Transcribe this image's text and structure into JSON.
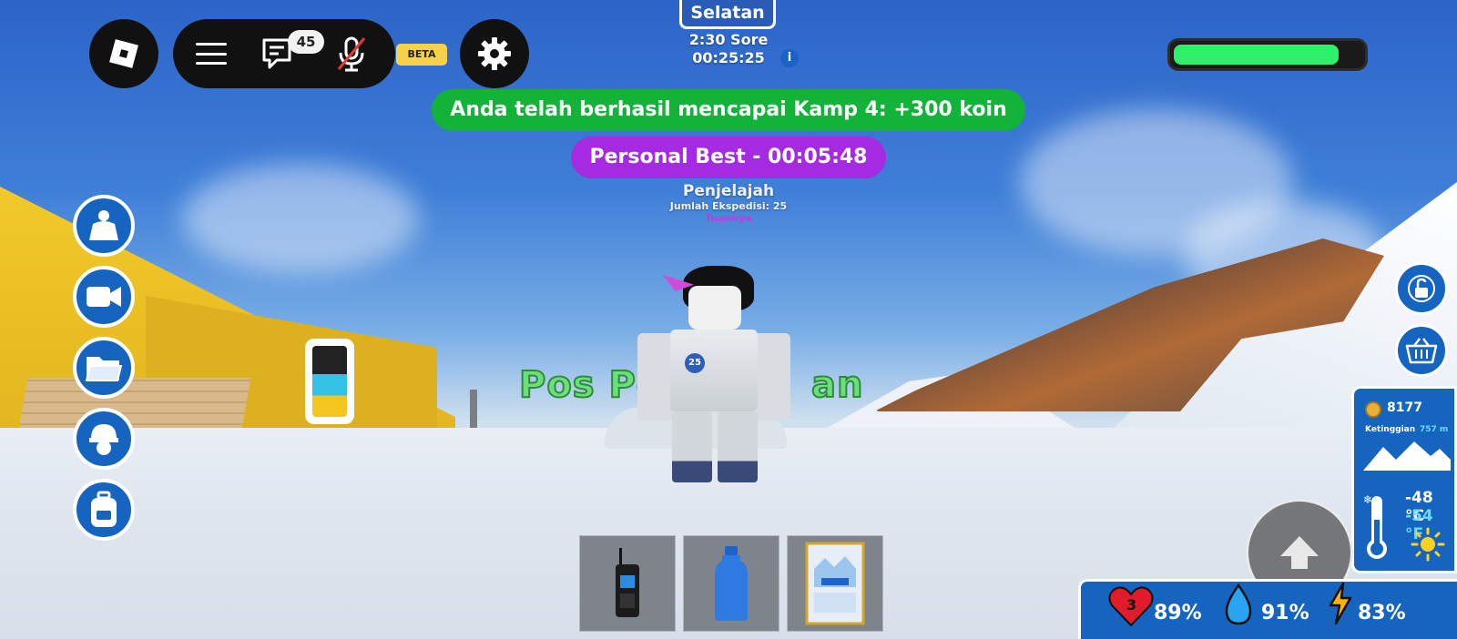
{
  "hud": {
    "chat_count": "45",
    "beta_label": "BETA",
    "compass_direction": "Selatan",
    "time_of_day": "2:30 Sore",
    "elapsed_time": "00:25:25",
    "info_glyph": "i",
    "health_fraction": 0.88
  },
  "notifications": {
    "camp_reached": "Anda telah berhasil mencapai Kamp 4: +300 koin",
    "personal_best": "Personal Best - 00:05:48"
  },
  "player": {
    "title": "Penjelajah",
    "expeditions": "Jumlah Ekspedisi: 25",
    "rank": "Tuannya",
    "suit_badge": "25"
  },
  "world": {
    "sign_text": "Pos Pe    an"
  },
  "sidebar": [
    {
      "name": "outfit-icon"
    },
    {
      "name": "camera-icon"
    },
    {
      "name": "folder-icon"
    },
    {
      "name": "helmet-icon"
    },
    {
      "name": "backpack-icon"
    }
  ],
  "stats": {
    "coins": "8177",
    "altitude_label": "Ketinggian",
    "altitude_value": "757 m",
    "temp_c": "-48 °C",
    "temp_f": "-54 °F"
  },
  "hotbar": [
    {
      "name": "walkie-talkie-icon"
    },
    {
      "name": "water-bottle-icon"
    },
    {
      "name": "map-item-icon"
    }
  ],
  "vitals": {
    "lives": "3",
    "health_pct": "89%",
    "water_pct": "91%",
    "energy_pct": "83%"
  },
  "colors": {
    "panel_blue": "#1565c0",
    "notif_green": "#13b33a",
    "notif_purple": "#a52be2",
    "health_green": "#2ef06a"
  }
}
